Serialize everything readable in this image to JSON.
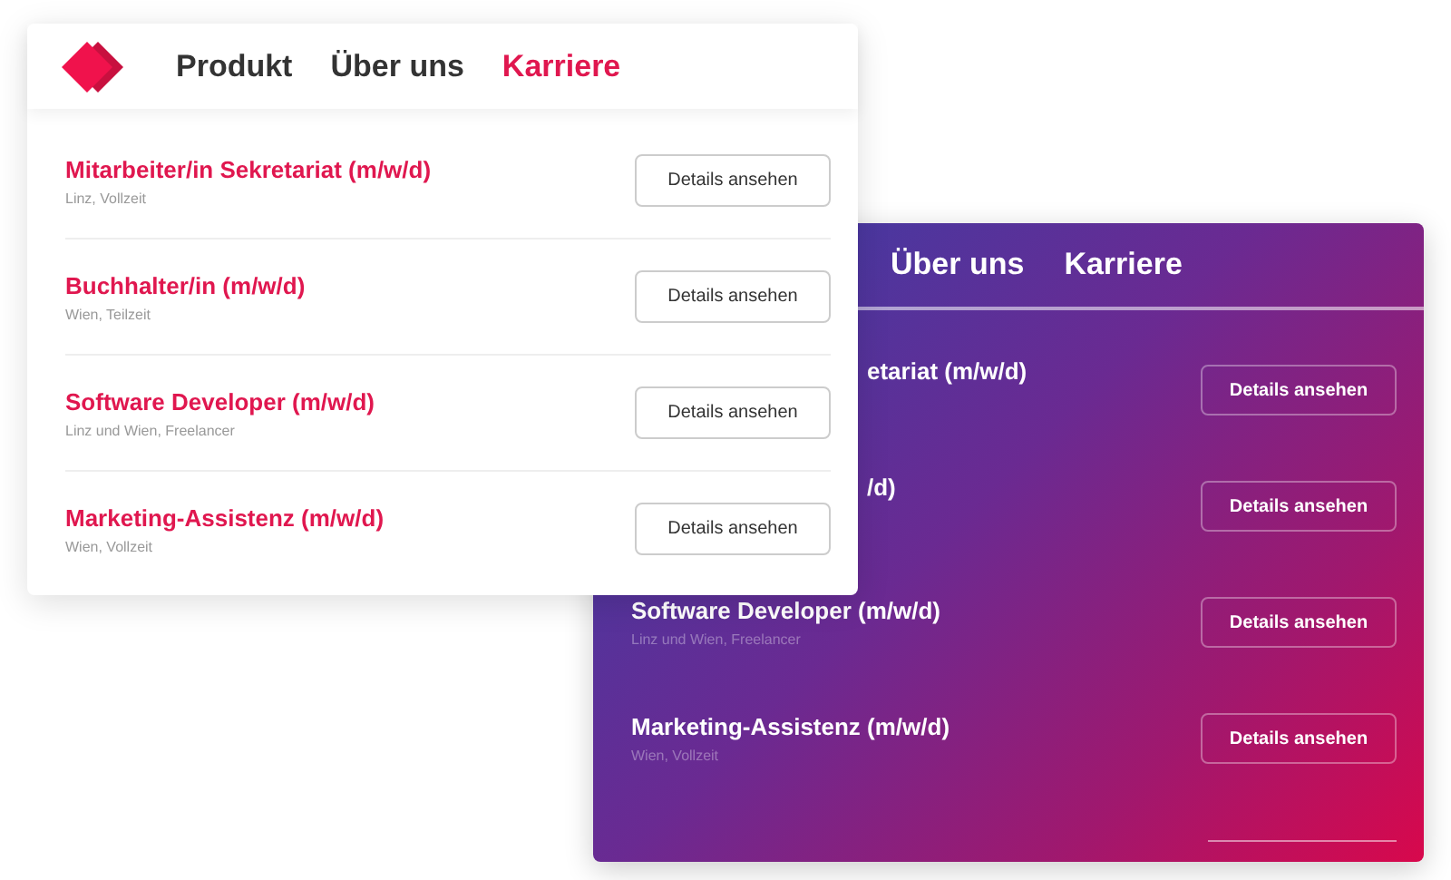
{
  "front_card": {
    "nav": [
      {
        "label": "Produkt",
        "selected": false
      },
      {
        "label": "Über uns",
        "selected": false
      },
      {
        "label": "Karriere",
        "selected": true
      }
    ],
    "jobs": [
      {
        "title": "Mitarbeiter/in Sekretariat (m/w/d)",
        "meta": "Linz, Vollzeit",
        "button": "Details ansehen"
      },
      {
        "title": "Buchhalter/in (m/w/d)",
        "meta": "Wien, Teilzeit",
        "button": "Details ansehen"
      },
      {
        "title": "Software Developer (m/w/d)",
        "meta": "Linz und Wien, Freelancer",
        "button": "Details ansehen"
      },
      {
        "title": "Marketing-Assistenz (m/w/d)",
        "meta": "Wien, Vollzeit",
        "button": "Details ansehen"
      }
    ]
  },
  "back_card": {
    "nav": [
      {
        "label": "Über uns"
      },
      {
        "label": "Karriere"
      }
    ],
    "jobs": [
      {
        "title": "etariat (m/w/d)",
        "button": "Details ansehen"
      },
      {
        "title": "/d)",
        "button": "Details ansehen"
      },
      {
        "title": "Software Developer (m/w/d)",
        "meta": "Linz und Wien, Freelancer",
        "button": "Details ansehen"
      },
      {
        "title": "Marketing-Assistenz (m/w/d)",
        "meta": "Wien, Vollzeit",
        "button": "Details ansehen"
      }
    ]
  }
}
